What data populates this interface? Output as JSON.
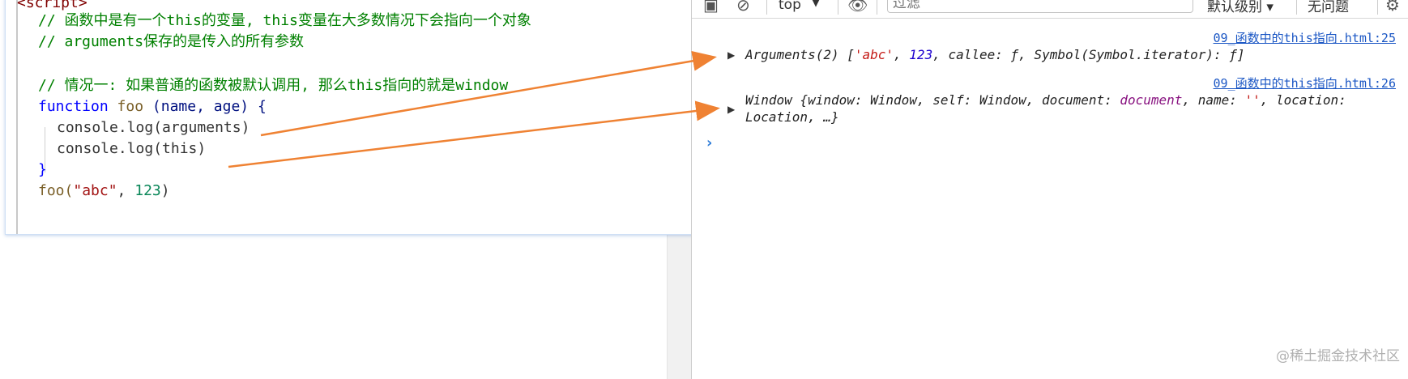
{
  "code": {
    "tag_open": "<script>",
    "comment1": "// 函数中是有一个this的变量, this变量在大多数情况下会指向一个对象",
    "comment2": "// arguments保存的是传入的所有参数",
    "comment3": "// 情况一: 如果普通的函数被默认调用, 那么this指向的就是window",
    "fn_keyword": "function",
    "fn_name": "foo",
    "params": "(name, age) {",
    "line_log1": "console.log(arguments)",
    "line_log2": "console.log(this)",
    "close_brace": "}",
    "call_name": "foo(",
    "call_str": "\"abc\"",
    "call_sep": ", ",
    "call_num": "123",
    "call_end": ")"
  },
  "devtools": {
    "context": "top",
    "filter_placeholder": "过滤",
    "level": "默认级别 ▾",
    "issues": "无问题",
    "logs": [
      {
        "source": "09_函数中的this指向.html:25",
        "prefix": "Arguments(2) [",
        "str": "'abc'",
        "sep": ", ",
        "num": "123",
        "rest": ", callee: ƒ, Symbol(Symbol.iterator): ƒ]"
      },
      {
        "source": "09_函数中的this指向.html:26",
        "line1_a": "Window {window: Window, self: Window, document: ",
        "line1_doc": "document",
        "line1_b": ", name: ",
        "line1_str": "''",
        "line1_c": ", location:",
        "line2": "Location, …}"
      }
    ]
  },
  "watermark": "@稀土掘金技术社区",
  "colors": {
    "arrow": "#ef8233",
    "link": "#1a56c4"
  }
}
